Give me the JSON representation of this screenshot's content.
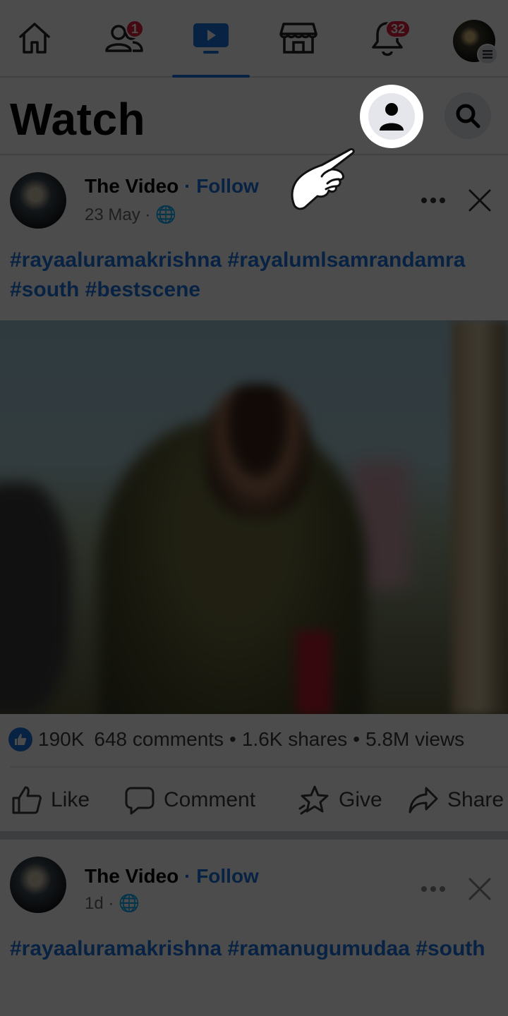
{
  "nav": {
    "tabs": [
      {
        "name": "home",
        "icon": "home-icon"
      },
      {
        "name": "friends",
        "icon": "friends-icon",
        "badge": "1"
      },
      {
        "name": "watch",
        "icon": "video-icon",
        "active": true
      },
      {
        "name": "marketplace",
        "icon": "store-icon"
      },
      {
        "name": "notifications",
        "icon": "bell-icon",
        "badge": "32"
      },
      {
        "name": "menu",
        "icon": "profile-avatar"
      }
    ]
  },
  "header": {
    "title": "Watch"
  },
  "post1": {
    "author": "The Video",
    "separator": "·",
    "follow_label": "Follow",
    "meta": "23 May · 🌐",
    "hashtags": "#rayaaluramakrishna #rayalumlsamrandamra #south #bestscene",
    "stats": {
      "reactions": "190K",
      "comments": "648 comments",
      "dot1": "•",
      "shares": "1.6K shares",
      "dot2": "•",
      "views": "5.8M views"
    },
    "actions": {
      "like": "Like",
      "comment": "Comment",
      "give": "Give",
      "share": "Share"
    }
  },
  "post2": {
    "author": "The Video",
    "separator": "·",
    "follow_label": "Follow",
    "meta": "1d · 🌐",
    "hashtags": "#rayaaluramakrishna #ramanugumudaa #south"
  },
  "colors": {
    "accent": "#1b74e4",
    "badge": "#e41e3f",
    "overlay": "rgba(0,0,0,0.70)"
  },
  "tutorial": {
    "pointer_icon": "pointing-hand-icon",
    "highlighted": "profile-button"
  }
}
